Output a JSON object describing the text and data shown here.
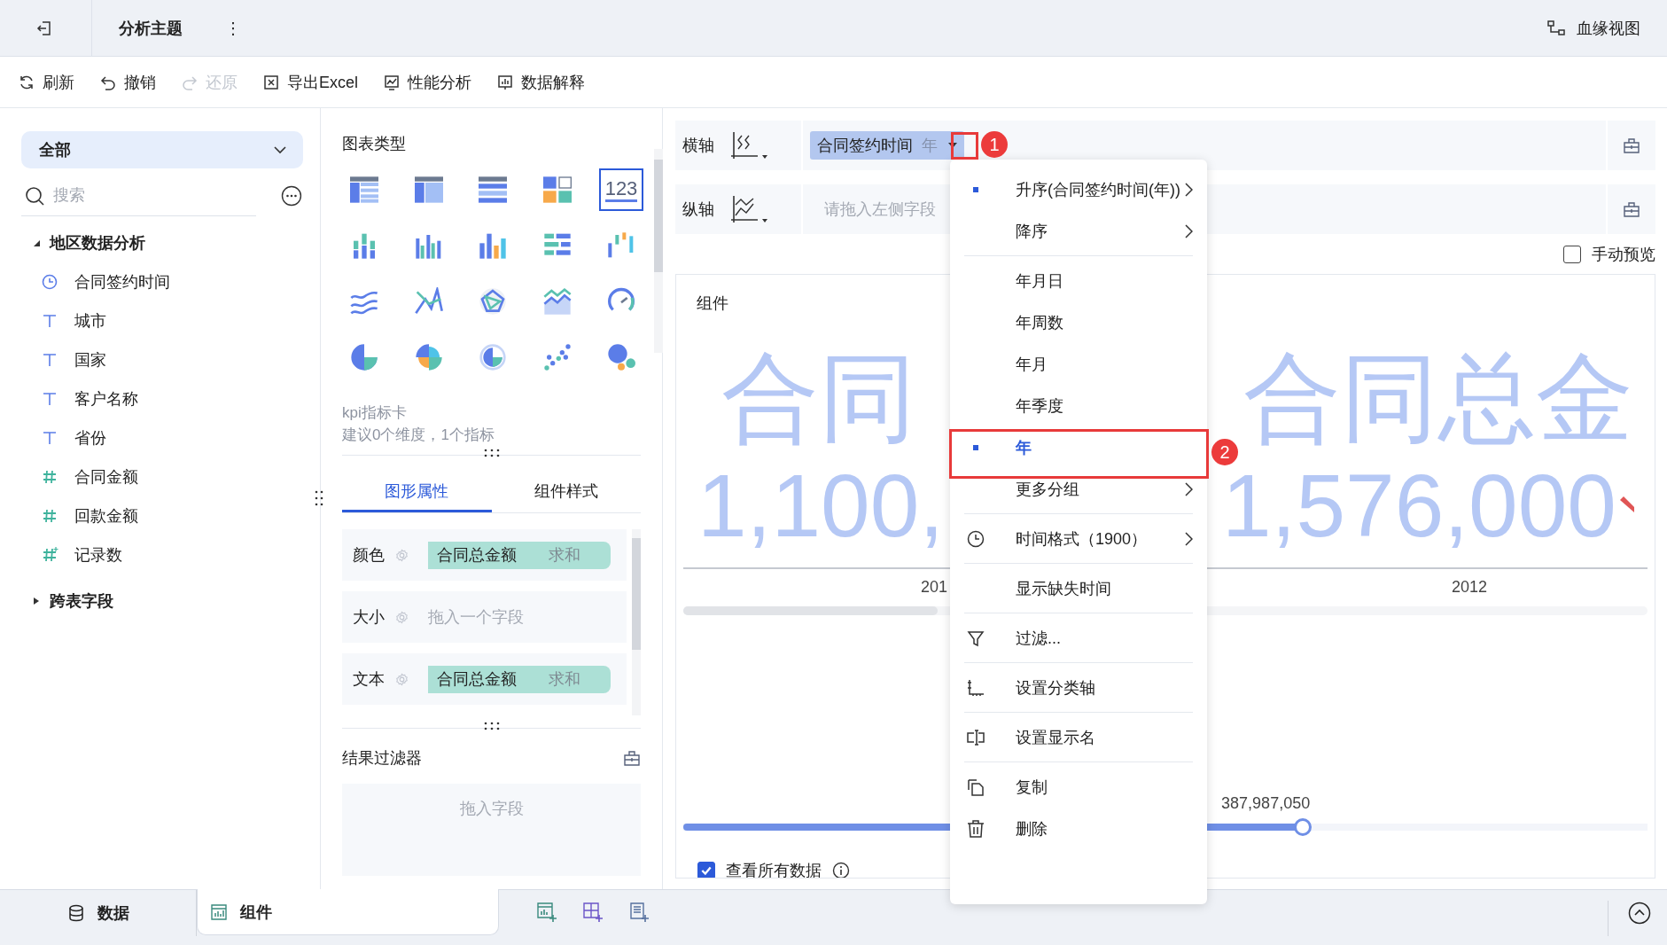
{
  "topbar": {
    "title": "分析主题",
    "more": "⋮",
    "lineage": "血缘视图"
  },
  "toolbar": [
    {
      "label": "刷新",
      "kind": "refresh",
      "disabled": false
    },
    {
      "label": "撤销",
      "kind": "undo",
      "disabled": false
    },
    {
      "label": "还原",
      "kind": "redo",
      "disabled": true
    },
    {
      "label": "导出Excel",
      "kind": "export",
      "disabled": false
    },
    {
      "label": "性能分析",
      "kind": "perf",
      "disabled": false
    },
    {
      "label": "数据解释",
      "kind": "explain",
      "disabled": false
    }
  ],
  "sidebar": {
    "scope": "全部",
    "search_placeholder": "搜索",
    "tree": [
      {
        "label": "地区数据分析",
        "expanded": true,
        "children": [
          {
            "label": "合同签约时间",
            "kind": "time"
          },
          {
            "label": "城市",
            "kind": "text"
          },
          {
            "label": "国家",
            "kind": "text"
          },
          {
            "label": "客户名称",
            "kind": "text"
          },
          {
            "label": "省份",
            "kind": "text"
          },
          {
            "label": "合同金额",
            "kind": "number"
          },
          {
            "label": "回款金额",
            "kind": "number"
          },
          {
            "label": "记录数",
            "kind": "count"
          }
        ]
      },
      {
        "label": "跨表字段",
        "expanded": false
      }
    ]
  },
  "chart_types": {
    "title": "图表类型",
    "items": [
      {
        "kind": "table",
        "selected": false
      },
      {
        "kind": "cross",
        "selected": false
      },
      {
        "kind": "detail",
        "selected": false
      },
      {
        "kind": "blocks",
        "selected": false
      },
      {
        "kind": "kpi",
        "label": "123",
        "selected": true
      },
      {
        "kind": "stack",
        "selected": false
      },
      {
        "kind": "multibar",
        "selected": false
      },
      {
        "kind": "bar",
        "selected": false
      },
      {
        "kind": "hbar",
        "selected": false
      },
      {
        "kind": "waterfall",
        "selected": false
      },
      {
        "kind": "lines",
        "selected": false
      },
      {
        "kind": "polyline",
        "selected": false
      },
      {
        "kind": "radar",
        "selected": false
      },
      {
        "kind": "area",
        "selected": false
      },
      {
        "kind": "gauge",
        "selected": false
      },
      {
        "kind": "pie",
        "selected": false
      },
      {
        "kind": "rose",
        "selected": false
      },
      {
        "kind": "ring",
        "selected": false
      },
      {
        "kind": "scatter",
        "selected": false
      },
      {
        "kind": "bubble",
        "selected": false
      }
    ],
    "name": "kpi指标卡",
    "hint": "建议0个维度，1个指标"
  },
  "property_tabs": [
    {
      "label": "图形属性",
      "selected": true
    },
    {
      "label": "组件样式",
      "selected": false
    }
  ],
  "properties": [
    {
      "label": "颜色",
      "field": "合同总金额",
      "agg": "求和"
    },
    {
      "label": "大小",
      "placeholder": "拖入一个字段"
    },
    {
      "label": "文本",
      "field": "合同总金额",
      "agg": "求和"
    }
  ],
  "result_filter": {
    "title": "结果过滤器",
    "placeholder": "拖入字段"
  },
  "axes": [
    {
      "label": "横轴",
      "kind": "x",
      "field": "合同签约时间",
      "unit": "年"
    },
    {
      "label": "纵轴",
      "kind": "y",
      "placeholder": "请拖入左侧字段"
    }
  ],
  "manual_preview": {
    "label": "手动预览",
    "checked": false
  },
  "component": {
    "title": "组件",
    "kpis": [
      {
        "title": "合同",
        "value": "1,100,",
        "x_label": "201",
        "indicator": false
      },
      {
        "title": "合同总金",
        "value": "1,576,000",
        "x_label": "2012",
        "indicator": true
      }
    ],
    "slider": {
      "label": "387,987,050",
      "level": 0.65
    },
    "show_all": {
      "label": "查看所有数据",
      "checked": true
    }
  },
  "menu": [
    [
      {
        "label": "升序(合同签约时间(年))",
        "checked": true,
        "selected": false,
        "submenu": true
      },
      {
        "label": "降序",
        "checked": false,
        "selected": false,
        "submenu": true
      }
    ],
    [
      {
        "label": "年月日",
        "checked": false,
        "selected": false,
        "submenu": false
      },
      {
        "label": "年周数",
        "checked": false,
        "selected": false,
        "submenu": false
      },
      {
        "label": "年月",
        "checked": false,
        "selected": false,
        "submenu": false
      },
      {
        "label": "年季度",
        "checked": false,
        "selected": false,
        "submenu": false
      },
      {
        "label": "年",
        "checked": true,
        "selected": true,
        "submenu": false
      },
      {
        "label": "更多分组",
        "checked": false,
        "selected": false,
        "submenu": true
      }
    ],
    [
      {
        "label": "时间格式（1900）",
        "kind": "clock",
        "checked": false,
        "selected": false,
        "submenu": true
      }
    ],
    [
      {
        "label": "显示缺失时间",
        "checked": false,
        "selected": false,
        "submenu": false
      }
    ],
    [
      {
        "label": "过滤...",
        "kind": "filter",
        "checked": false,
        "selected": false,
        "submenu": false
      }
    ],
    [
      {
        "label": "设置分类轴",
        "kind": "axis",
        "checked": false,
        "selected": false,
        "submenu": false
      }
    ],
    [
      {
        "label": "设置显示名",
        "kind": "rename",
        "checked": false,
        "selected": false,
        "submenu": false
      }
    ],
    [
      {
        "label": "复制",
        "kind": "copy",
        "checked": false,
        "selected": false,
        "submenu": false
      },
      {
        "label": "删除",
        "kind": "trash",
        "checked": false,
        "selected": false,
        "submenu": false
      }
    ]
  ],
  "annotations": [
    "1",
    "2"
  ],
  "bottom_tabs": [
    {
      "label": "数据",
      "kind": "database",
      "selected": false
    },
    {
      "label": "组件",
      "kind": "chart",
      "selected": true
    }
  ]
}
